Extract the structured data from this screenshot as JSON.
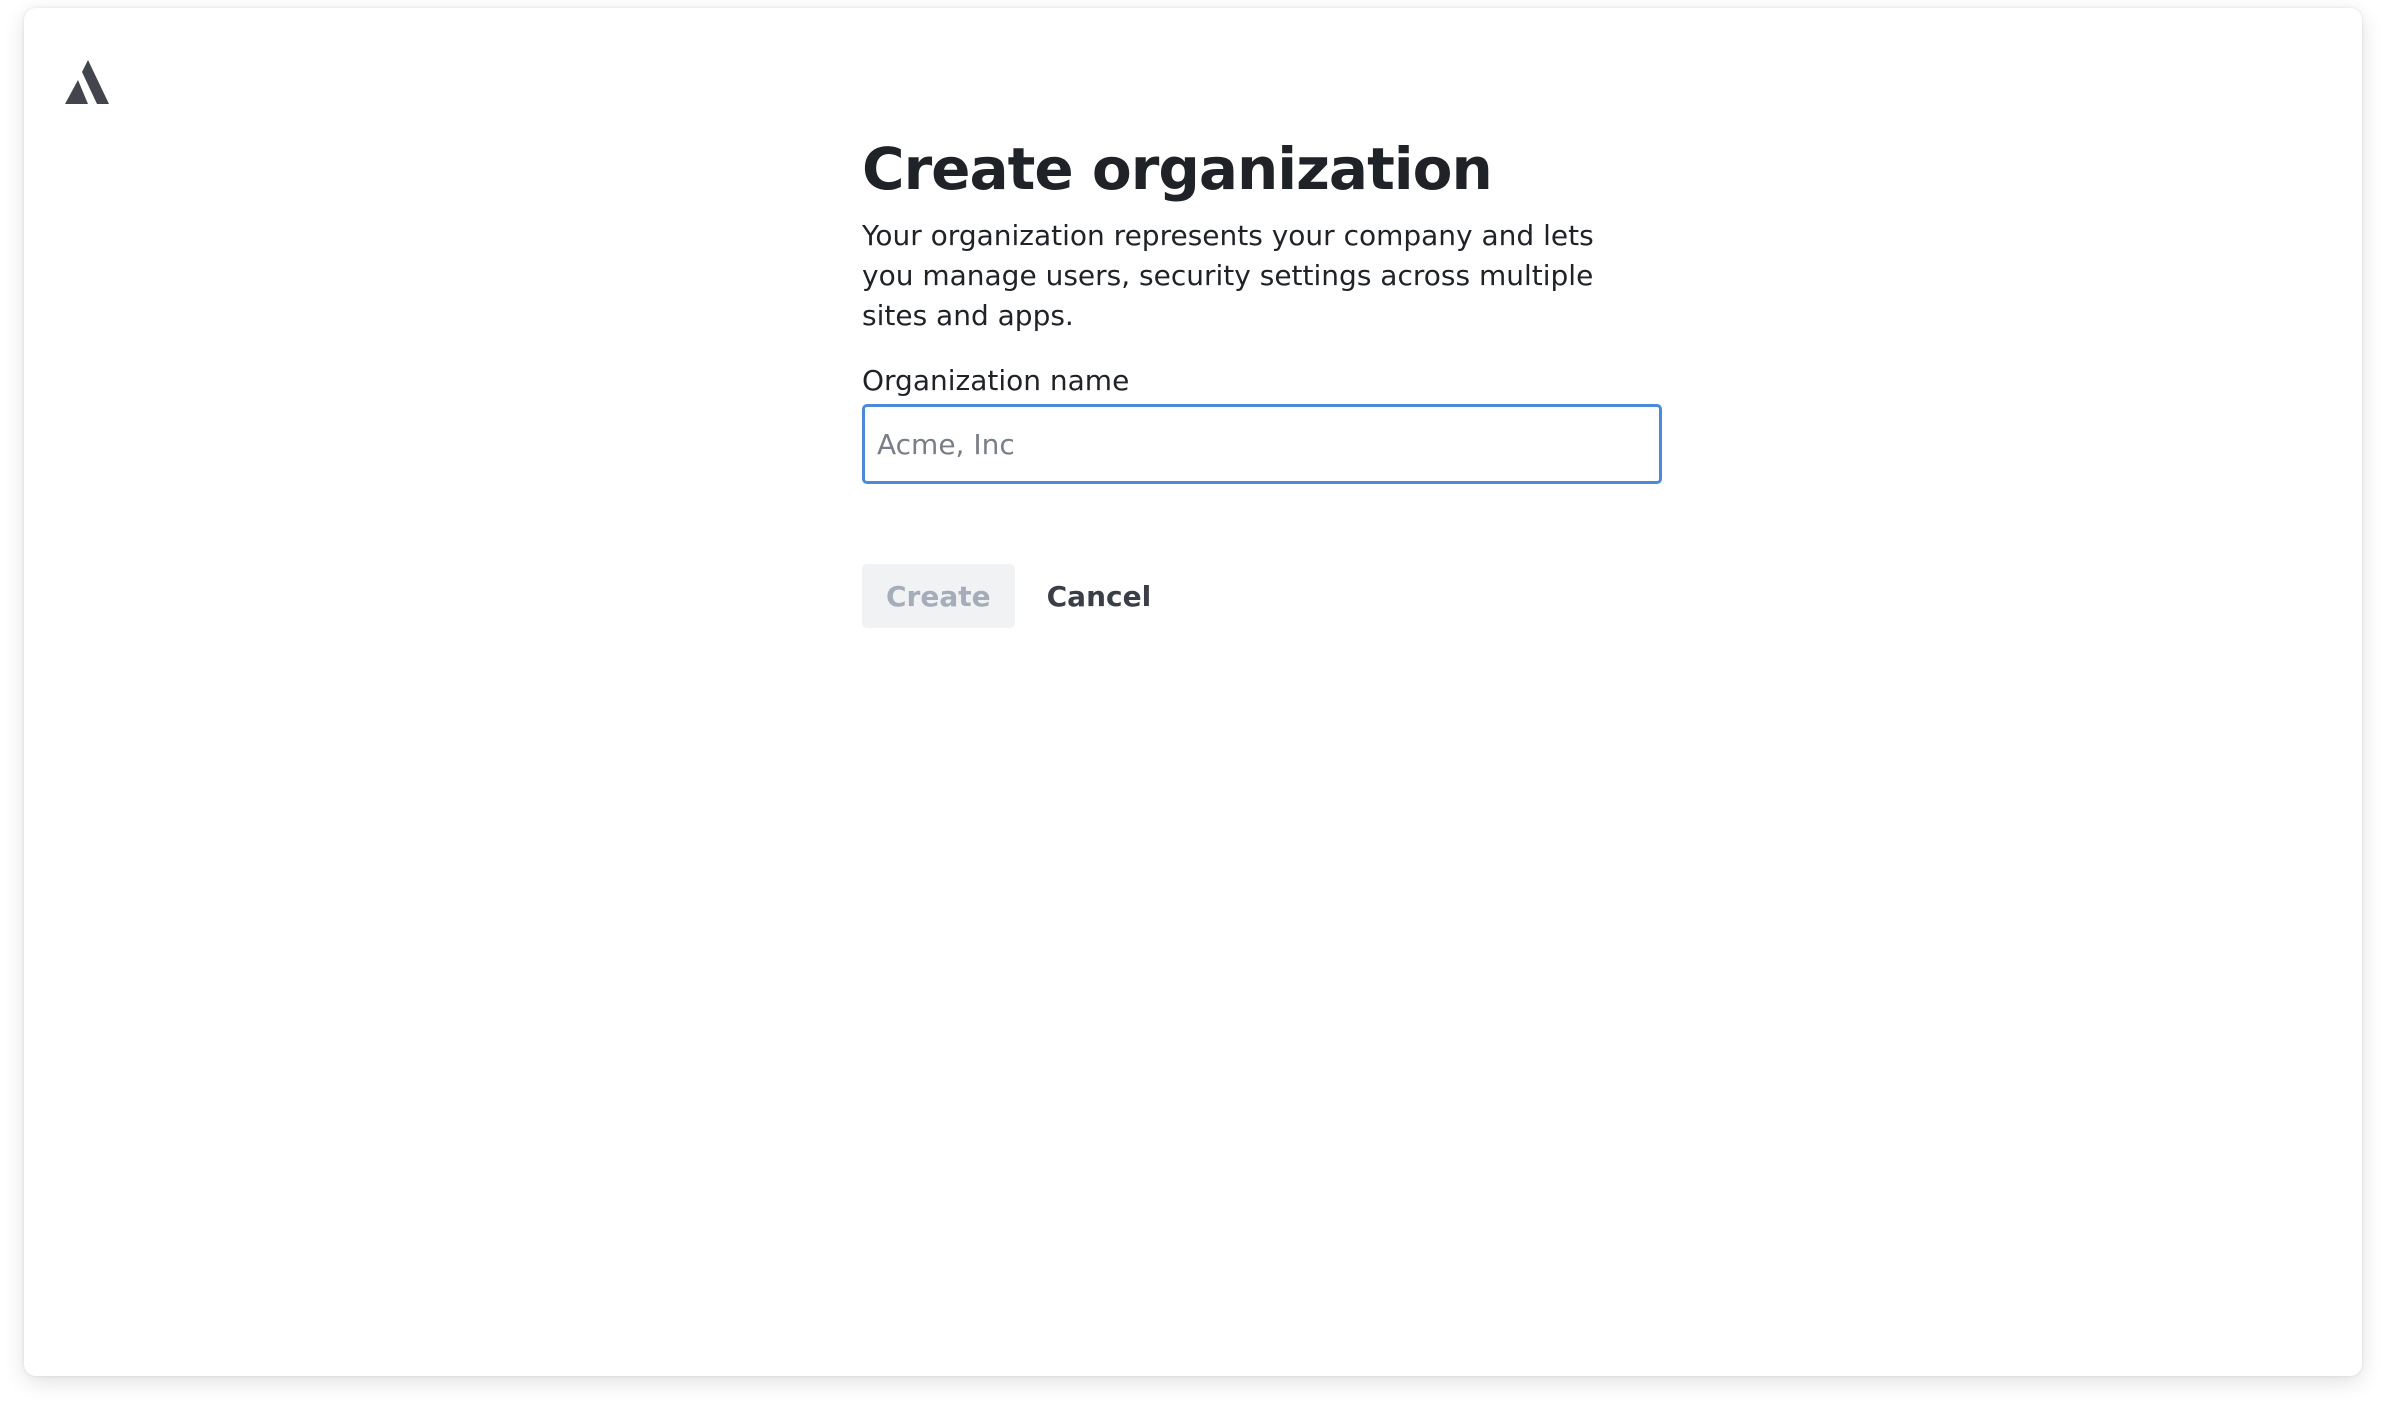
{
  "brand": {
    "logo_icon": "atlassian-logo-icon",
    "logo_color": "#42454c"
  },
  "page": {
    "title": "Create organization",
    "description": "Your organization represents your company and lets you manage users, security settings across multiple sites and apps."
  },
  "form": {
    "org_name_label": "Organization name",
    "org_name_placeholder": "Acme, Inc",
    "org_name_value": "",
    "focus_color": "#4c8ad9"
  },
  "actions": {
    "create_label": "Create",
    "create_disabled": true,
    "cancel_label": "Cancel"
  }
}
